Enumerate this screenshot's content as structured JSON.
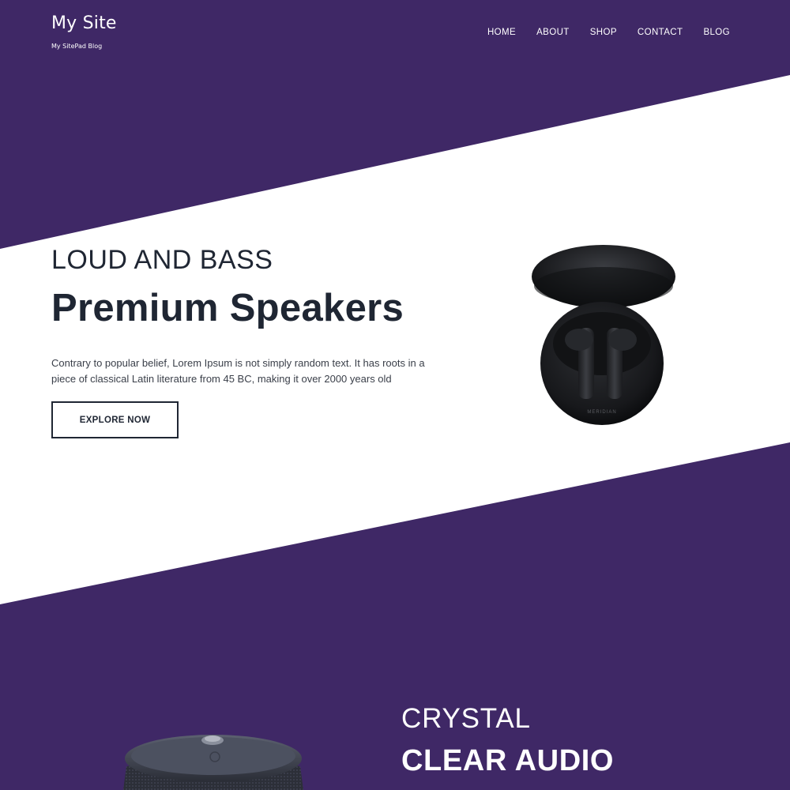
{
  "header": {
    "site_title": "My Site",
    "tagline": "My SitePad Blog",
    "nav": [
      {
        "label": "HOME"
      },
      {
        "label": "ABOUT"
      },
      {
        "label": "SHOP"
      },
      {
        "label": "CONTACT"
      },
      {
        "label": "BLOG"
      }
    ]
  },
  "hero": {
    "kicker": "LOUD AND BASS",
    "title": "Premium Speakers",
    "body": "Contrary to popular belief, Lorem Ipsum is not simply random text. It has roots in a piece of classical Latin literature from 45 BC, making it over 2000 years old",
    "button_label": "EXPLORE NOW",
    "product_brand_text": "MERIDIAN"
  },
  "section2": {
    "kicker": "CRYSTAL",
    "title": "CLEAR AUDIO"
  },
  "colors": {
    "brand_purple": "#3f2866",
    "hero_band": "#ffffff",
    "dark_text": "#1f2633"
  },
  "icons": {
    "product_image": "earbuds-case-image",
    "speaker_image": "bluetooth-speaker-image"
  }
}
